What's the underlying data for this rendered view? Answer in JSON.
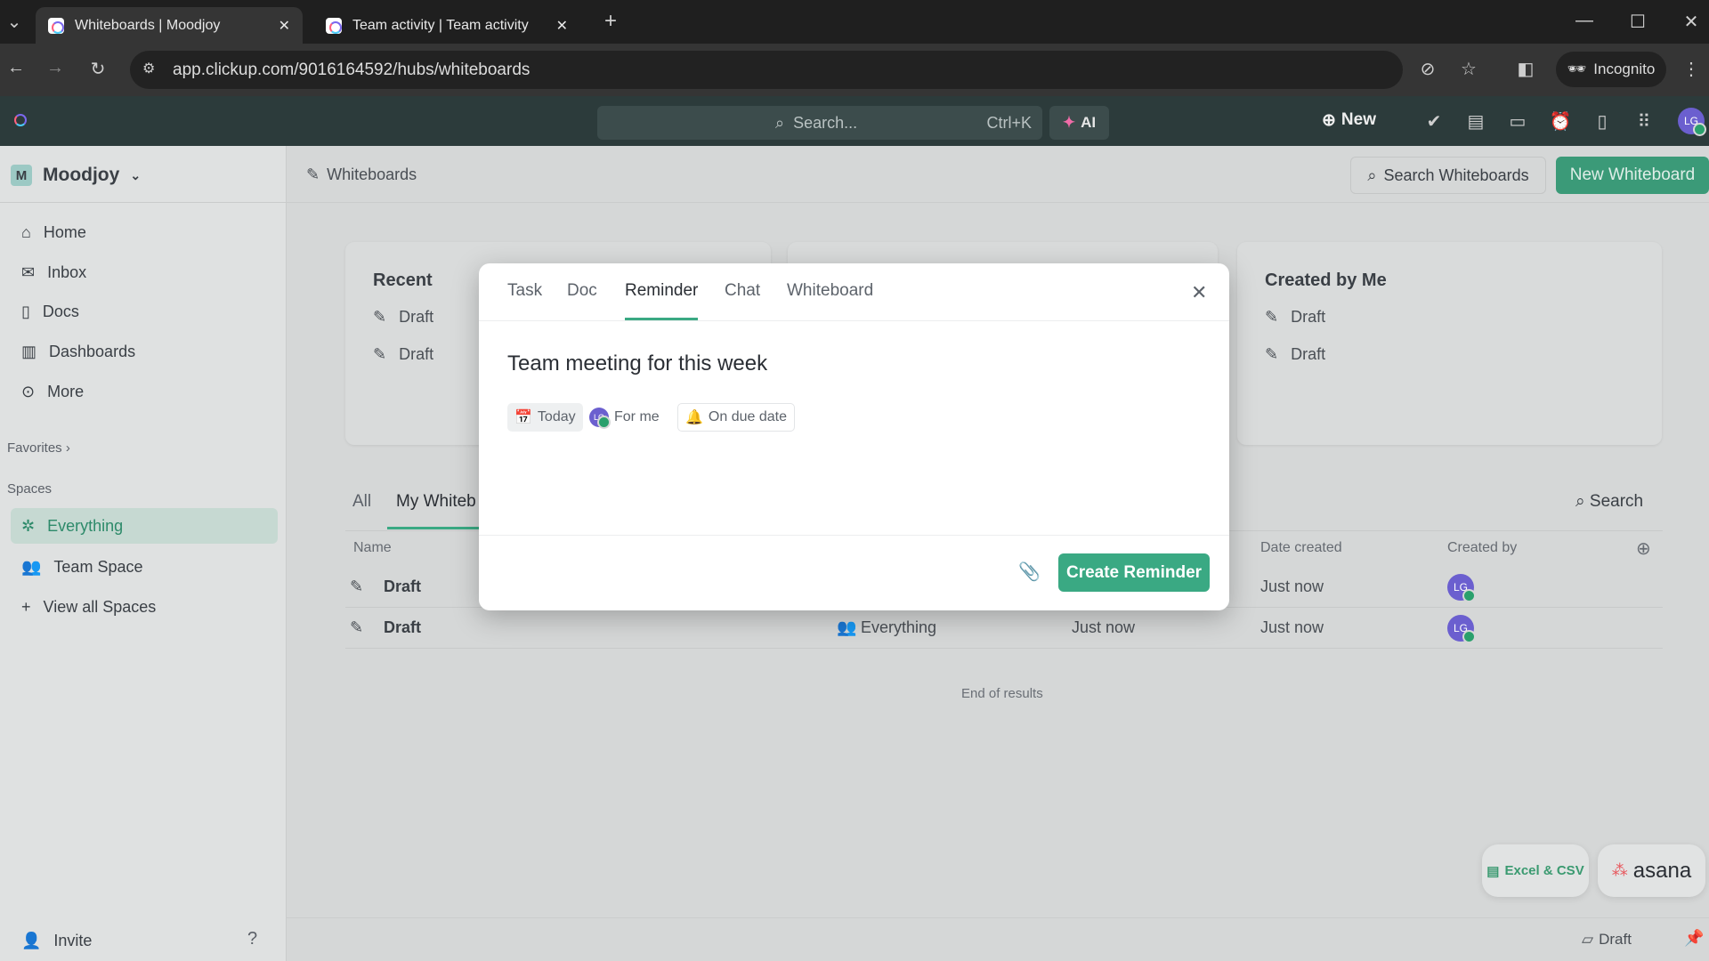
{
  "browser": {
    "tabs": [
      {
        "title": "Whiteboards | Moodjoy",
        "active": true
      },
      {
        "title": "Team activity | Team activity",
        "active": false
      }
    ],
    "url": "app.clickup.com/9016164592/hubs/whiteboards",
    "incognito": "Incognito"
  },
  "topbar": {
    "search_placeholder": "Search...",
    "shortcut": "Ctrl+K",
    "ai": "AI",
    "new": "New"
  },
  "sidebar": {
    "workspace_initial": "M",
    "workspace": "Moodjoy",
    "items": [
      {
        "label": "Home"
      },
      {
        "label": "Inbox"
      },
      {
        "label": "Docs"
      },
      {
        "label": "Dashboards"
      },
      {
        "label": "More"
      }
    ],
    "favorites": "Favorites",
    "spaces": "Spaces",
    "space_items": [
      {
        "label": "Everything",
        "selected": true
      },
      {
        "label": "Team Space"
      },
      {
        "label": "View all Spaces"
      }
    ],
    "invite": "Invite"
  },
  "header": {
    "title": "Whiteboards",
    "search": "Search Whiteboards",
    "new": "New Whiteboard"
  },
  "cards": {
    "recent": {
      "title": "Recent",
      "items": [
        "Draft",
        "Draft"
      ]
    },
    "created": {
      "title": "Created by Me",
      "items": [
        "Draft",
        "Draft"
      ]
    }
  },
  "list": {
    "tabs": [
      "All",
      "My Whiteb"
    ],
    "search": "Search",
    "columns": {
      "name": "Name",
      "date_created": "Date created",
      "created_by": "Created by"
    },
    "rows": [
      {
        "name": "Draft",
        "location": "",
        "updated": "",
        "created": "Just now",
        "avatar": "LG"
      },
      {
        "name": "Draft",
        "location": "Everything",
        "updated": "Just now",
        "created": "Just now",
        "avatar": "LG"
      }
    ],
    "end": "End of results"
  },
  "modal": {
    "tabs": [
      "Task",
      "Doc",
      "Reminder",
      "Chat",
      "Whiteboard"
    ],
    "active_tab": "Reminder",
    "title": "Team meeting for this week",
    "chips": {
      "date": "Today",
      "assignee_initials": "LG",
      "assignee": "For me",
      "notify": "On due date"
    },
    "create": "Create Reminder"
  },
  "widgets": {
    "excel": "Excel & CSV",
    "asana": "asana"
  },
  "footer": {
    "draft": "Draft"
  },
  "colors": {
    "accent": "#3aa983",
    "avatar": "#6b5fcf"
  }
}
